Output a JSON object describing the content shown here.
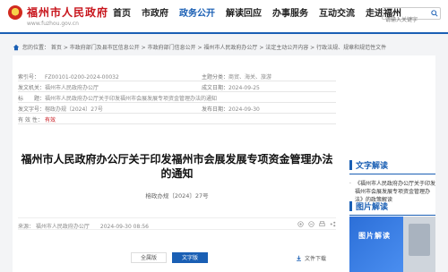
{
  "site": {
    "title": "福州市人民政府",
    "url": "www.fuzhou.gov.cn"
  },
  "nav": {
    "items": [
      "首页",
      "市政府",
      "政务公开",
      "解读回应",
      "办事服务",
      "互动交流",
      "走进福州"
    ],
    "active_index": 2
  },
  "search": {
    "placeholder": "请输入关键字"
  },
  "breadcrumb": {
    "text": "您的位置： 首页 > 市政府部门及县市区信息公开 > 市政府部门信息公开 > 福州市人民政府办公厅 > 法定主动公开内容 > 行政法规、规章和规范性文件"
  },
  "info": {
    "index_label": "索引号：",
    "index_value": "FZ00101-0200-2024-00032",
    "category_label": "主题分类：",
    "category_value": "商贸、海关、旅游",
    "issuer_label": "发文机关：",
    "issuer_value": "福州市人民政府办公厅",
    "date_label": "成文日期：",
    "date_value": "2024-09-25",
    "title_label": "标　　题：",
    "title_value": "福州市人民政府办公厅关于印发福州市会展发展专项资金管理办法的通知",
    "docno_label": "发文字号：",
    "docno_value": "榕政办规〔2024〕27号",
    "pubdate_label": "发布日期：",
    "pubdate_value": "2024-09-30",
    "validity_label": "有 效 性：",
    "validity_value": "有效"
  },
  "document": {
    "title": "福州市人民政府办公厅关于印发福州市会展发展专项资金管理办法的通知",
    "number": "榕政办规〔2024〕27号",
    "source": "来源： 福州市人民政府办公厅　　2024-09-30 08:56"
  },
  "tabs": {
    "items": [
      "全属版",
      "文字版"
    ],
    "active_index": 1
  },
  "download": {
    "label": "文件下载"
  },
  "sidebar": {
    "text_interpretation": {
      "title": "文字解读",
      "links": [
        "《福州市人民政府办公厅关于印发福州市会展发展专项资金管理办法》的政策解读"
      ]
    },
    "pic_interpretation": {
      "title": "图片解读",
      "card_text": "图片解读"
    }
  },
  "colors": {
    "brand_red": "#c8161d",
    "brand_blue": "#1a5fb4"
  }
}
